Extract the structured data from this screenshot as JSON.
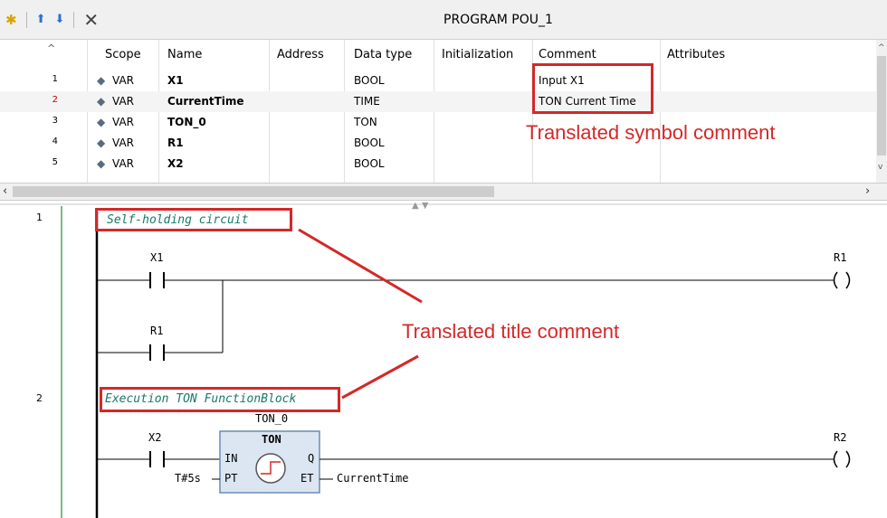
{
  "toolbar": {
    "title": "PROGRAM POU_1",
    "icons": [
      "new-item-icon",
      "arrow-up-icon",
      "arrow-down-icon",
      "delete-icon"
    ]
  },
  "declaration": {
    "columns": [
      "Scope",
      "Name",
      "Address",
      "Data type",
      "Initialization",
      "Comment",
      "Attributes"
    ],
    "rows": [
      {
        "num": "1",
        "scope": "VAR",
        "name": "X1",
        "address": "",
        "type": "BOOL",
        "init": "",
        "comment": "Input X1",
        "attributes": ""
      },
      {
        "num": "2",
        "scope": "VAR",
        "name": "CurrentTime",
        "address": "",
        "type": "TIME",
        "init": "",
        "comment": "TON Current Time",
        "attributes": ""
      },
      {
        "num": "3",
        "scope": "VAR",
        "name": "TON_0",
        "address": "",
        "type": "TON",
        "init": "",
        "comment": "",
        "attributes": ""
      },
      {
        "num": "4",
        "scope": "VAR",
        "name": "R1",
        "address": "",
        "type": "BOOL",
        "init": "",
        "comment": "",
        "attributes": ""
      },
      {
        "num": "5",
        "scope": "VAR",
        "name": "X2",
        "address": "",
        "type": "BOOL",
        "init": "",
        "comment": "",
        "attributes": ""
      }
    ]
  },
  "annotations": {
    "symbol": "Translated symbol comment",
    "title": "Translated title comment"
  },
  "networks": [
    {
      "num": "1",
      "comment": "Self-holding circuit",
      "contact1": "X1",
      "contact2": "R1",
      "coil": "R1"
    },
    {
      "num": "2",
      "comment": "Execution TON FunctionBlock",
      "instance": "TON_0",
      "block": "TON",
      "contact": "X2",
      "pin_in": "IN",
      "pin_pt": "PT",
      "pin_q": "Q",
      "pin_et": "ET",
      "pt_value": "T#5s",
      "et_output": "CurrentTime",
      "coil": "R2"
    }
  ],
  "colors": {
    "annotation": "#d42828",
    "comment": "#167a6a",
    "block_fill": "#dce6f2"
  }
}
